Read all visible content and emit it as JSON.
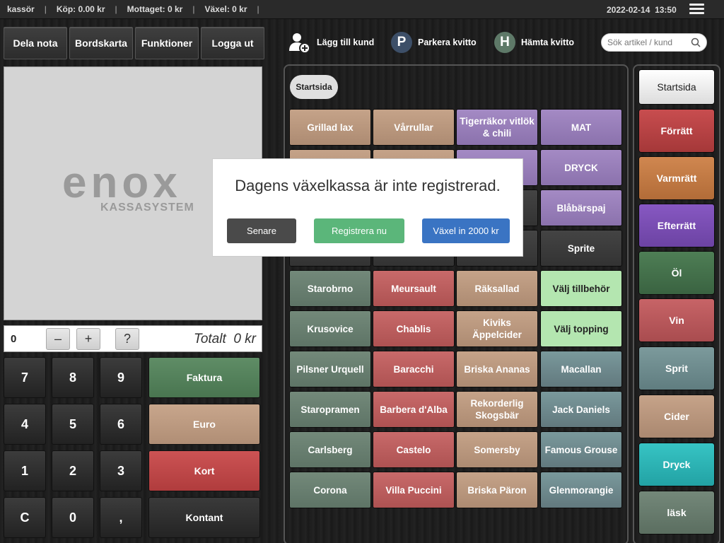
{
  "topbar": {
    "user": "kassör",
    "purchase": "Köp: 0.00 kr",
    "received": "Mottaget: 0 kr",
    "change": "Växel: 0 kr",
    "date": "2022-02-14",
    "time": "13:50"
  },
  "toolbar": {
    "split_bill": "Dela nota",
    "table_map": "Bordskarta",
    "functions": "Funktioner",
    "logout": "Logga ut"
  },
  "actions": {
    "add_customer": "Lägg till kund",
    "park_icon": "P",
    "park": "Parkera kvitto",
    "fetch_icon": "H",
    "fetch": "Hämta kvitto"
  },
  "search": {
    "placeholder": "Sök artikel / kund"
  },
  "logo": {
    "main": "enox",
    "sub": "KASSASYSTEM"
  },
  "order": {
    "quantity": "0",
    "minus": "–",
    "plus": "+",
    "help": "?",
    "total_label": "Totalt",
    "total_value": "0 kr"
  },
  "keypad": [
    "7",
    "8",
    "9",
    "4",
    "5",
    "6",
    "1",
    "2",
    "3",
    "C",
    "0",
    ","
  ],
  "payment": {
    "invoice": "Faktura",
    "euro": "Euro",
    "card": "Kort",
    "cash": "Kontant"
  },
  "breadcrumb": {
    "home": "Startsida"
  },
  "products": [
    "Grillad lax",
    "Vårrullar",
    "Tigerräkor vitlök & chili",
    "MAT",
    "",
    "",
    "",
    "DRYCK",
    "",
    "",
    "",
    "Blåbärspaj",
    "",
    "",
    "",
    "Sprite",
    "Starobrno",
    "Meursault",
    "Räksallad",
    "Välj tillbehör",
    "Krusovice",
    "Chablis",
    "Kiviks Äppelcider",
    "Välj topping",
    "Pilsner Urquell",
    "Baracchi",
    "Briska Ananas",
    "Macallan",
    "Staropramen",
    "Barbera d'Alba",
    "Rekorderlig Skogsbär",
    "Jack Daniels",
    "Carlsberg",
    "Castelo",
    "Somersby",
    "Famous Grouse",
    "Corona",
    "Villa Puccini",
    "Briska Päron",
    "Glenmorangie"
  ],
  "categories": [
    "Startsida",
    "Förrätt",
    "Varmrätt",
    "Efterrätt",
    "Öl",
    "Vin",
    "Sprit",
    "Cider",
    "Dryck",
    "läsk"
  ],
  "modal": {
    "message": "Dagens växelkassa är inte registrerad.",
    "later": "Senare",
    "register": "Registrera nu",
    "change_in": "Växel in 2000 kr"
  },
  "colors": {
    "invoice": "#55825c",
    "euro": "#c5a389",
    "card": "#c34748",
    "cash": "#2e2e2e",
    "modal_later": "#4a4a4a",
    "modal_register": "#5bb67a",
    "modal_change": "#3a74c3"
  }
}
